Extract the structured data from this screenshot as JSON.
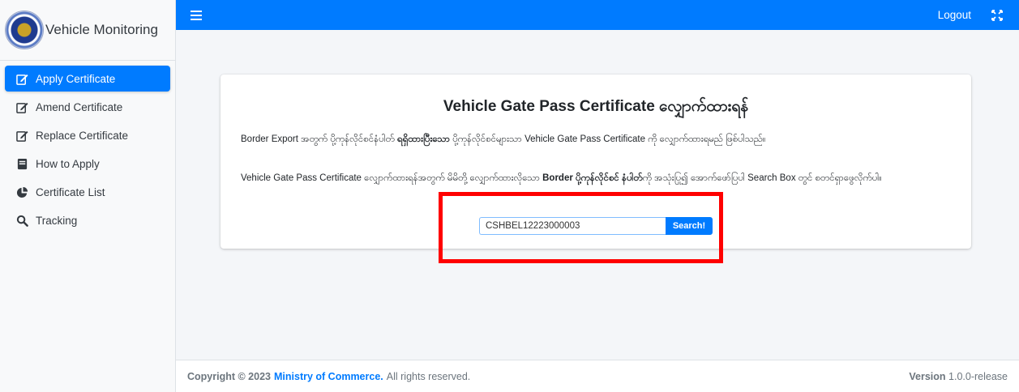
{
  "sidebar": {
    "brand_title": "Vehicle Monitoring",
    "items": [
      {
        "label": "Apply Certificate",
        "icon": "edit-icon",
        "active": true
      },
      {
        "label": "Amend Certificate",
        "icon": "edit-icon",
        "active": false
      },
      {
        "label": "Replace Certificate",
        "icon": "edit-icon",
        "active": false
      },
      {
        "label": "How to Apply",
        "icon": "book-icon",
        "active": false
      },
      {
        "label": "Certificate List",
        "icon": "pie-chart-icon",
        "active": false
      },
      {
        "label": "Tracking",
        "icon": "search-icon",
        "active": false
      }
    ]
  },
  "topbar": {
    "logout_label": "Logout"
  },
  "card": {
    "title": "Vehicle Gate Pass Certificate လျှောက်ထားရန်",
    "paragraph1_a": "Border Export အတွက် ပို့ကုန်လိုင်စင်နံပါတ် ",
    "paragraph1_b": "ရရှိထားပြီးသော",
    "paragraph1_c": " ပို့ကုန်လိုင်စင်များသာ Vehicle Gate Pass Certificate ကို လျှောက်ထားရမည် ဖြစ်ပါသည်။",
    "paragraph2_a": "Vehicle Gate Pass Certificate လျှောက်ထားရန်အတွက် မိမိတို့ လျှောက်ထားလိုသော ",
    "paragraph2_b": "Border ပို့ကုန်လိုင်စင် နံပါတ်",
    "paragraph2_c": "ကို အသုံးပြု၍ အောက်ဖော်ပြပါ Search Box တွင် စတင်ရှာဖွေလိုက်ပါ။",
    "search_value": "CSHBEL12223000003",
    "search_button_label": "Search!"
  },
  "footer": {
    "copyright_label": "Copyright © 2023",
    "ministry": "Ministry of Commerce.",
    "rights": "All rights reserved.",
    "version_label": "Version",
    "version_value": "1.0.0-release"
  },
  "colors": {
    "primary": "#007bff",
    "highlight": "#ff0000"
  }
}
